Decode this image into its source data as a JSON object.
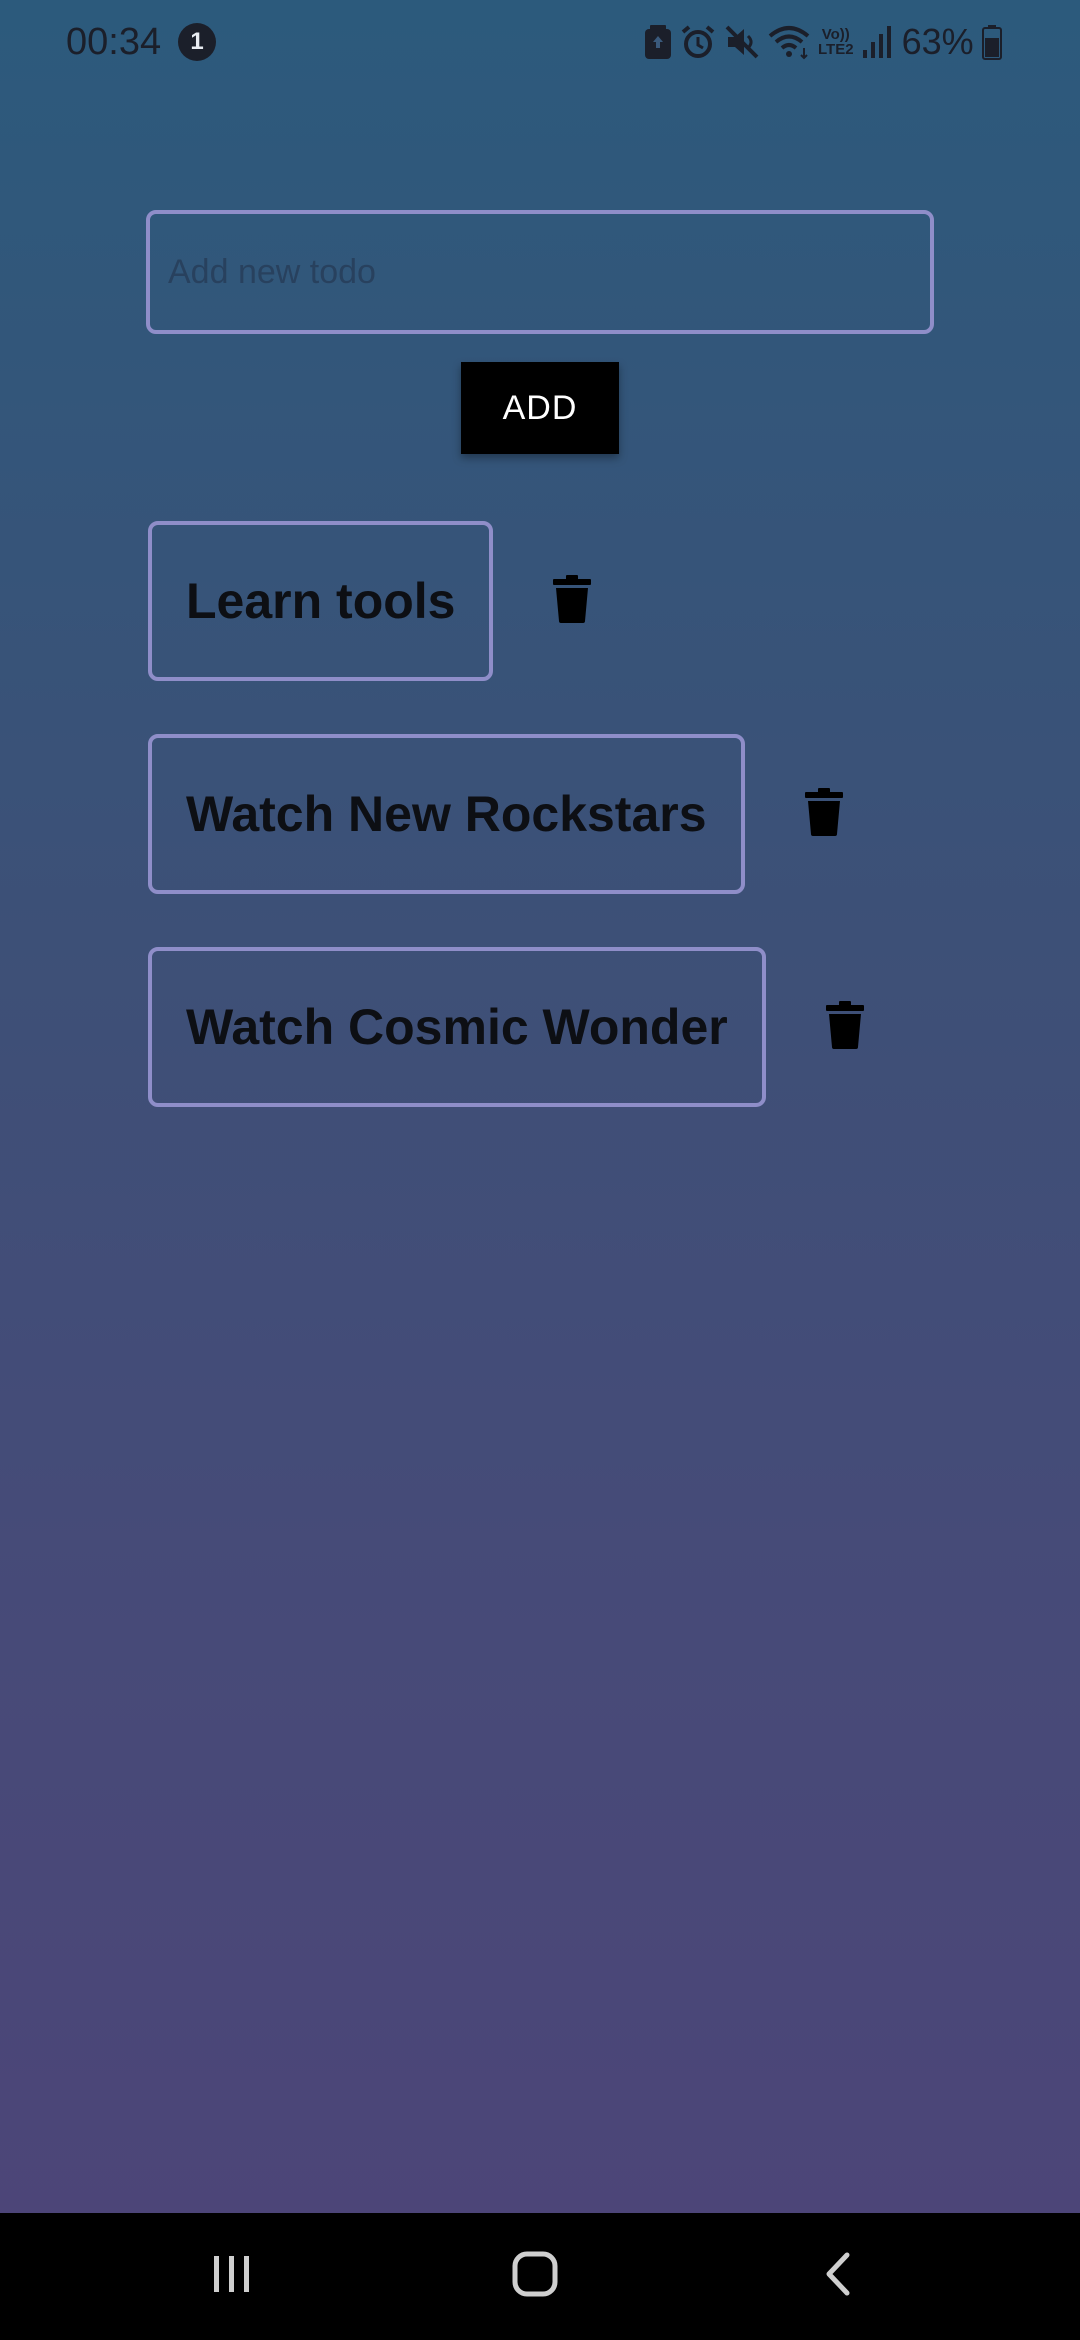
{
  "status_bar": {
    "time": "00:34",
    "notification_count": "1",
    "icons": [
      "battery-saver-icon",
      "alarm-icon",
      "mute-icon",
      "wifi-icon",
      "volte-lte2-icon",
      "signal-icon"
    ],
    "volte_top": "Vo))",
    "volte_bottom": "LTE2",
    "battery_percent": "63%"
  },
  "todo_form": {
    "input_value": "",
    "placeholder": "Add new todo",
    "add_label": "ADD"
  },
  "todos": [
    {
      "text": "Learn tools"
    },
    {
      "text": "Watch New Rockstars"
    },
    {
      "text": "Watch Cosmic Wonder"
    }
  ],
  "nav_bar": {
    "icons": [
      "recents-icon",
      "home-icon",
      "back-icon"
    ]
  },
  "colors": {
    "gradient_top": "#2c5a7c",
    "gradient_bottom": "#4d4478",
    "border_accent": "#8f8ec9",
    "button_bg": "#000000",
    "button_text": "#ffffff"
  }
}
